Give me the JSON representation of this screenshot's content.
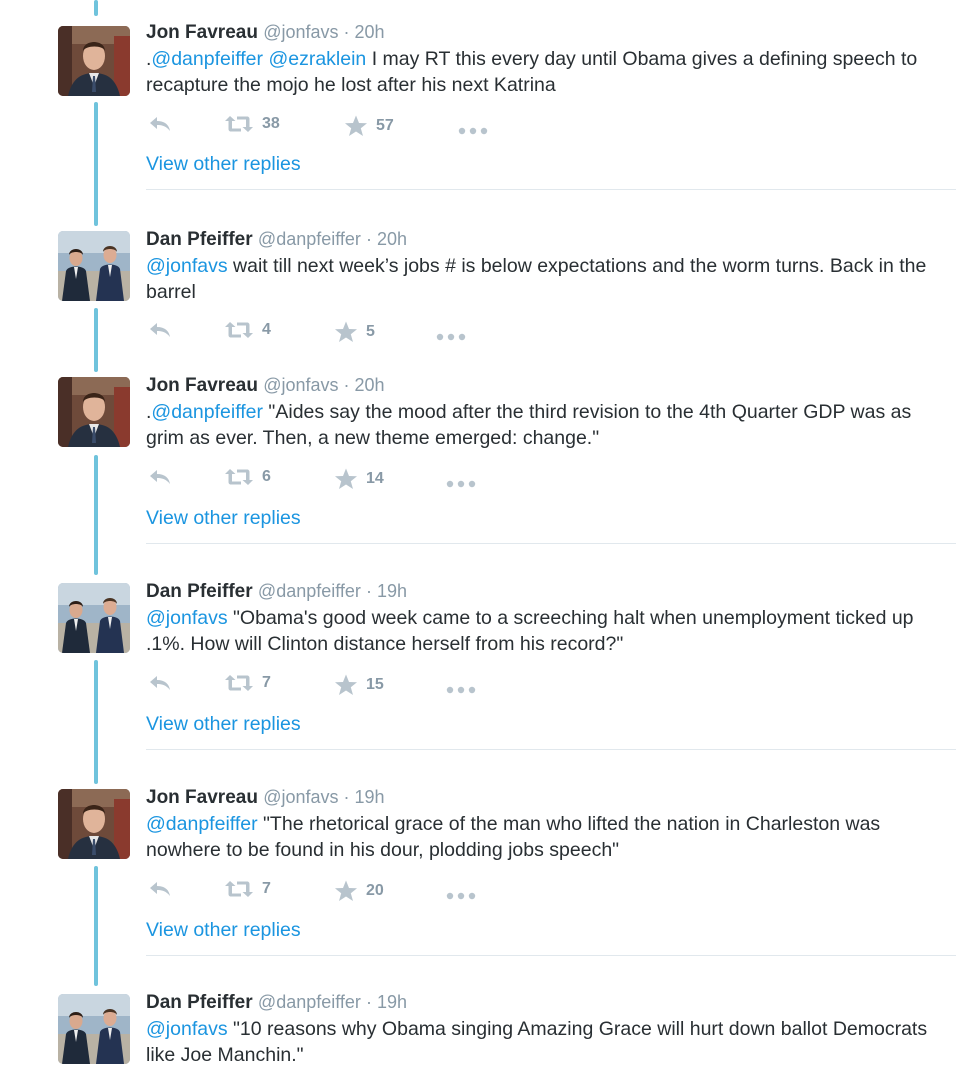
{
  "tweets": [
    {
      "author": "Jon Favreau",
      "handle": "@jonfavs",
      "time": "20h",
      "avatar": "jon-avatar",
      "prefix": ".",
      "mentions": [
        "@danpfeiffer",
        "@ezraklein"
      ],
      "text": " I may RT this every day until Obama gives a defining speech to recapture the mojo he lost after his next Katrina",
      "retweets": "38",
      "likes": "57",
      "view_replies": "View other replies"
    },
    {
      "author": "Dan Pfeiffer",
      "handle": "@danpfeiffer",
      "time": "20h",
      "avatar": "dan-avatar",
      "prefix": "",
      "mentions": [
        "@jonfavs"
      ],
      "text": " wait till next week’s jobs # is below expectations and the worm turns. Back in the barrel",
      "retweets": "4",
      "likes": "5",
      "view_replies": ""
    },
    {
      "author": "Jon Favreau",
      "handle": "@jonfavs",
      "time": "20h",
      "avatar": "jon-avatar",
      "prefix": ".",
      "mentions": [
        "@danpfeiffer"
      ],
      "text": " \"Aides say the mood after the third revision to the 4th Quarter GDP was as grim as ever. Then, a new theme emerged: change.\"",
      "retweets": "6",
      "likes": "14",
      "view_replies": "View other replies"
    },
    {
      "author": "Dan Pfeiffer",
      "handle": "@danpfeiffer",
      "time": "19h",
      "avatar": "dan-avatar",
      "prefix": "",
      "mentions": [
        "@jonfavs"
      ],
      "text": " \"Obama's good week came to a screeching halt when unemployment ticked up .1%. How will Clinton distance herself from his record?\"",
      "retweets": "7",
      "likes": "15",
      "view_replies": "View other replies"
    },
    {
      "author": "Jon Favreau",
      "handle": "@jonfavs",
      "time": "19h",
      "avatar": "jon-avatar",
      "prefix": "",
      "mentions": [
        "@danpfeiffer"
      ],
      "text": " \"The rhetorical grace of the man who lifted the nation in Charleston was nowhere to be found in his dour, plodding jobs speech\"",
      "retweets": "7",
      "likes": "20",
      "view_replies": "View other replies"
    },
    {
      "author": "Dan Pfeiffer",
      "handle": "@danpfeiffer",
      "time": "19h",
      "avatar": "dan-avatar",
      "prefix": "",
      "mentions": [
        "@jonfavs"
      ],
      "text": " \"10 reasons why Obama singing Amazing Grace will hurt down ballot Democrats like Joe Manchin.\"",
      "retweets": "",
      "likes": "",
      "view_replies": ""
    }
  ],
  "separator": " · ",
  "icons": {
    "reply": "reply-icon",
    "retweet": "retweet-icon",
    "like": "star-icon",
    "more": "more-dots-icon"
  },
  "colors": {
    "link": "#1b95e0",
    "muted": "#8899a6",
    "thread": "#6fc3dc",
    "text": "#292f33"
  }
}
